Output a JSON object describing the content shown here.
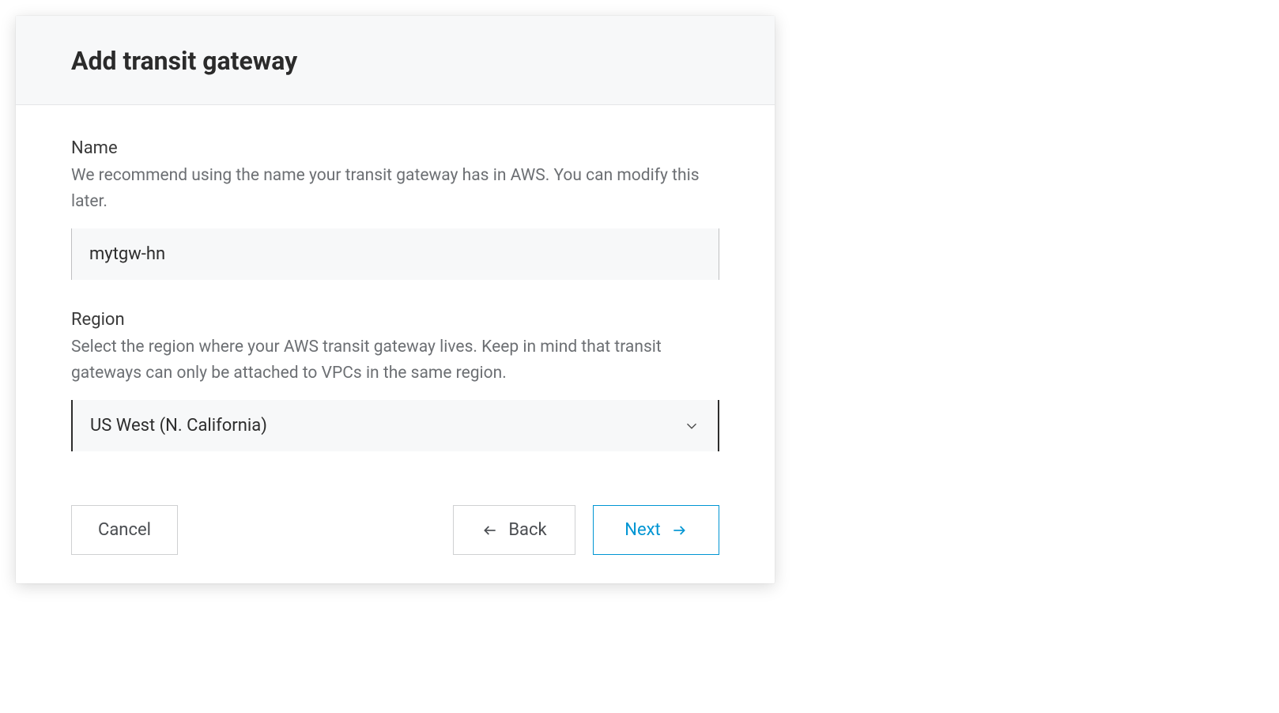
{
  "dialog": {
    "title": "Add transit gateway"
  },
  "form": {
    "name": {
      "label": "Name",
      "description": "We recommend using the name your transit gateway has in AWS. You can modify this later.",
      "value": "mytgw-hn"
    },
    "region": {
      "label": "Region",
      "description": "Select the region where your AWS transit gateway lives. Keep in mind that transit gateways can only be attached to VPCs in the same region.",
      "selected": "US West (N. California)"
    }
  },
  "buttons": {
    "cancel": "Cancel",
    "back": "Back",
    "next": "Next"
  }
}
